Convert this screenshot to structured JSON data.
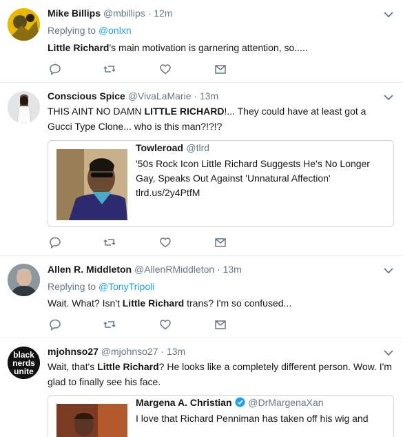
{
  "tweets": [
    {
      "name": "Mike Billips",
      "handle": "@mbillips",
      "time": "12m",
      "replying_label": "Replying to",
      "replying_to": "@onlxn",
      "text_bold": "Little Richard",
      "text_rest": "'s main motivation is garnering attention, so....."
    },
    {
      "name": "Conscious Spice",
      "handle": "@VivaLaMarie",
      "time": "13m",
      "text_pre": "THIS AINT NO DAMN ",
      "text_bold": "LITTLE RICHARD",
      "text_rest": "!... They could have at least got a Gucci Type Clone... who is this man?!?!?",
      "card": {
        "name": "Towleroad",
        "handle": "@tlrd",
        "text": "'50s Rock Icon Little Richard Suggests He's No Longer Gay, Speaks Out Against 'Unnatural Affection' tlrd.us/2y4PtfM"
      }
    },
    {
      "name": "Allen R. Middleton",
      "handle": "@AllenRMiddleton",
      "time": "13m",
      "replying_label": "Replying to",
      "replying_to": "@TonyTripoli",
      "text_pre": "Wait. What? Isn't ",
      "text_bold": "Little Richard",
      "text_rest": " trans? I'm so confused..."
    },
    {
      "name": "mjohnso27",
      "handle": "@mjohnso27",
      "time": "13m",
      "avatar_text": "black nerds unite",
      "text_pre": "Wait, that's ",
      "text_bold": "Little Richard",
      "text_rest": "? He looks like a completely different person. Wow. I'm glad to finally see his face.",
      "card": {
        "name": "Margena A. Christian",
        "handle": "@DrMargenaXan",
        "text": "I love that Richard Penniman has taken off his wig and"
      }
    }
  ],
  "colors": {
    "link": "#1da1f2",
    "muted": "#657786",
    "border": "#e6ecf0",
    "verified": "#1da1f2"
  },
  "icons": [
    "reply-icon",
    "retweet-icon",
    "like-icon",
    "message-icon",
    "chevron-down-icon",
    "verified-icon"
  ]
}
